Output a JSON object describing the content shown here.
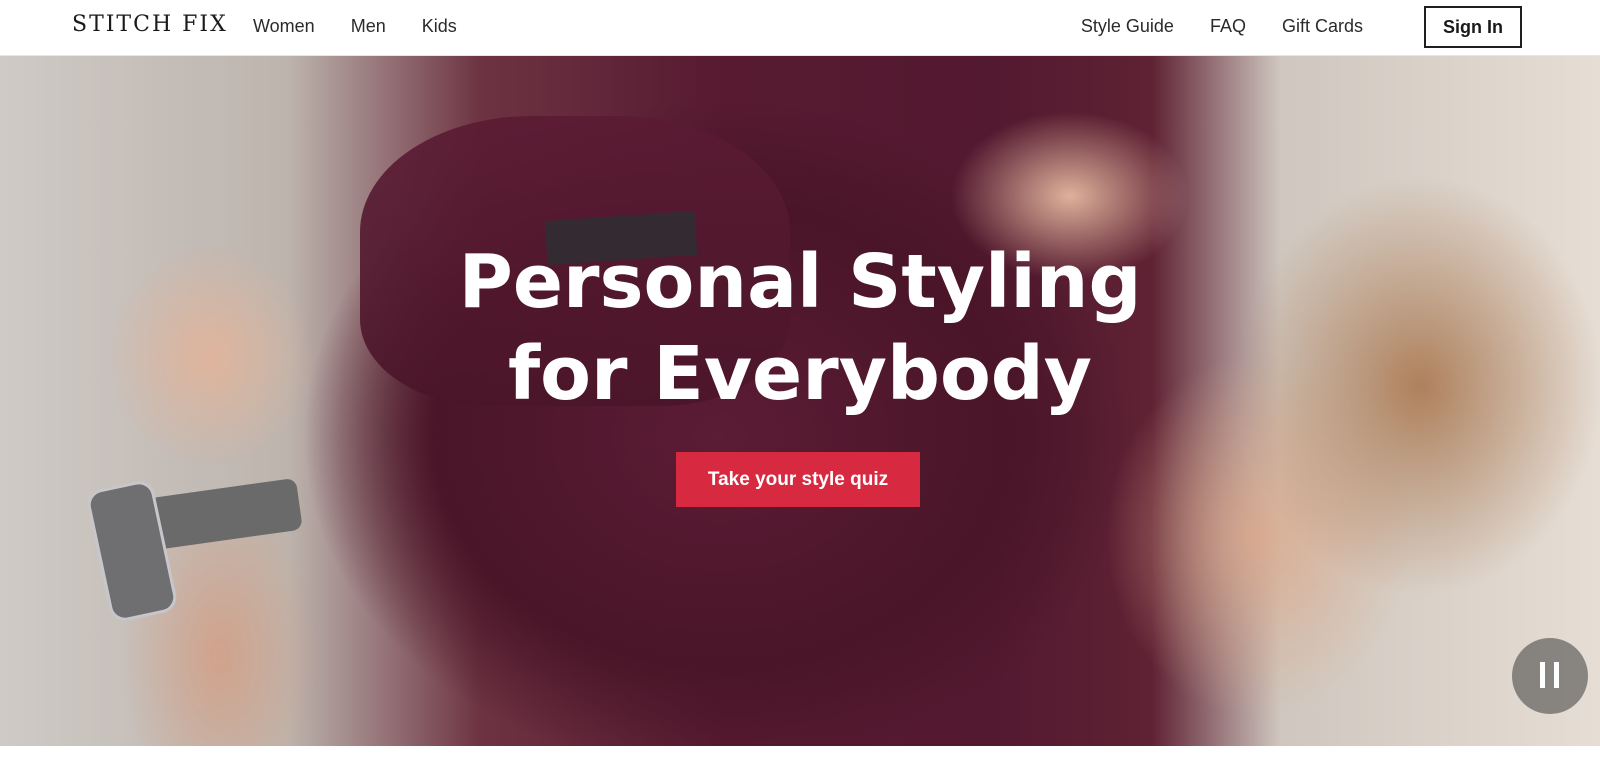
{
  "brand": {
    "logo_text": "STITCH FIX"
  },
  "nav": {
    "left": [
      {
        "label": "Women"
      },
      {
        "label": "Men"
      },
      {
        "label": "Kids"
      }
    ],
    "right": [
      {
        "label": "Style Guide"
      },
      {
        "label": "FAQ"
      },
      {
        "label": "Gift Cards"
      }
    ],
    "signin_label": "Sign In"
  },
  "hero": {
    "title_line1": "Personal Styling",
    "title_line2": "for Everybody",
    "cta_label": "Take your style quiz",
    "pause_icon": "pause-icon"
  },
  "colors": {
    "cta_background": "#d7293f",
    "cta_text": "#ffffff",
    "nav_text": "#2b2b2b"
  }
}
